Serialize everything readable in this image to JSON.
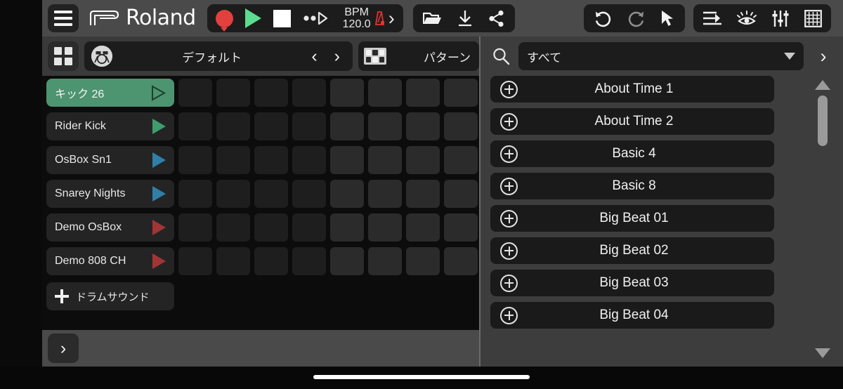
{
  "app": {
    "brand": "Roland"
  },
  "toolbar": {
    "menu_icon": "hamburger-menu-icon",
    "record_label": "Record",
    "play_label": "Play",
    "stop_label": "Stop",
    "step_label": "Step Playback",
    "bpm_label": "BPM",
    "bpm_value": "120.0",
    "bpm_chevron": "›",
    "file_icons": [
      "folder-open-icon",
      "download-icon",
      "share-icon"
    ],
    "edit_icons": [
      "undo-icon",
      "redo-icon",
      "cursor-arrow-icon"
    ],
    "view_icons": [
      "sequencer-icon",
      "eye-icon",
      "mixer-icon",
      "grid-icon"
    ]
  },
  "kitbar": {
    "grid_button": "kit-grid-icon",
    "kit_icon": "drum-kit-icon",
    "kit_name": "デフォルト",
    "prev": "‹",
    "next": "›",
    "pattern_icon": "pattern-grid-icon",
    "pattern_label": "パターン"
  },
  "tracks": [
    {
      "name": "キック 26",
      "color": "#4d9471",
      "selected": true,
      "play_color": "#1d3f2c",
      "hollow": true
    },
    {
      "name": "Rider Kick",
      "color": "#242424",
      "selected": false,
      "play_color": "#3f9c6d",
      "hollow": false
    },
    {
      "name": "OsBox Sn1",
      "color": "#242424",
      "selected": false,
      "play_color": "#2f7fa8",
      "hollow": false
    },
    {
      "name": "Snarey Nights",
      "color": "#242424",
      "selected": false,
      "play_color": "#2f7fa8",
      "hollow": false
    },
    {
      "name": "Demo OsBox",
      "color": "#242424",
      "selected": false,
      "play_color": "#a13535",
      "hollow": false
    },
    {
      "name": "Demo 808 CH",
      "color": "#242424",
      "selected": false,
      "play_color": "#a13535",
      "hollow": false
    }
  ],
  "sequencer": {
    "columns": 8,
    "rows": 6,
    "step_states": [
      [
        0,
        0,
        0,
        0,
        1,
        1,
        1,
        1
      ],
      [
        0,
        0,
        0,
        0,
        1,
        1,
        1,
        1
      ],
      [
        0,
        0,
        0,
        0,
        1,
        1,
        1,
        1
      ],
      [
        0,
        0,
        0,
        0,
        1,
        1,
        1,
        1
      ],
      [
        0,
        0,
        0,
        0,
        1,
        1,
        1,
        1
      ],
      [
        0,
        0,
        0,
        0,
        1,
        1,
        1,
        1
      ]
    ]
  },
  "add_sound": {
    "label": "ドラムサウンド",
    "icon": "plus-icon"
  },
  "bottom_bar": {
    "expand_chevron": "›"
  },
  "browser": {
    "search_icon": "search-icon",
    "filter_value": "すべて",
    "filter_caret": "chevron-down-icon",
    "next_chevron": "›",
    "items": [
      {
        "label": "About Time 1"
      },
      {
        "label": "About Time 2"
      },
      {
        "label": "Basic 4"
      },
      {
        "label": "Basic 8"
      },
      {
        "label": "Big Beat 01"
      },
      {
        "label": "Big Beat 02"
      },
      {
        "label": "Big Beat 03"
      },
      {
        "label": "Big Beat 04"
      }
    ],
    "scroll_up": "scroll-up-arrow",
    "scroll_down": "scroll-down-arrow"
  },
  "colors": {
    "accent_green": "#4d9471",
    "record_red": "#e2403c",
    "play_green": "#5ddc8f",
    "toolbar_bg": "#4a4a4a",
    "panel_bg": "#3d3d3d"
  }
}
